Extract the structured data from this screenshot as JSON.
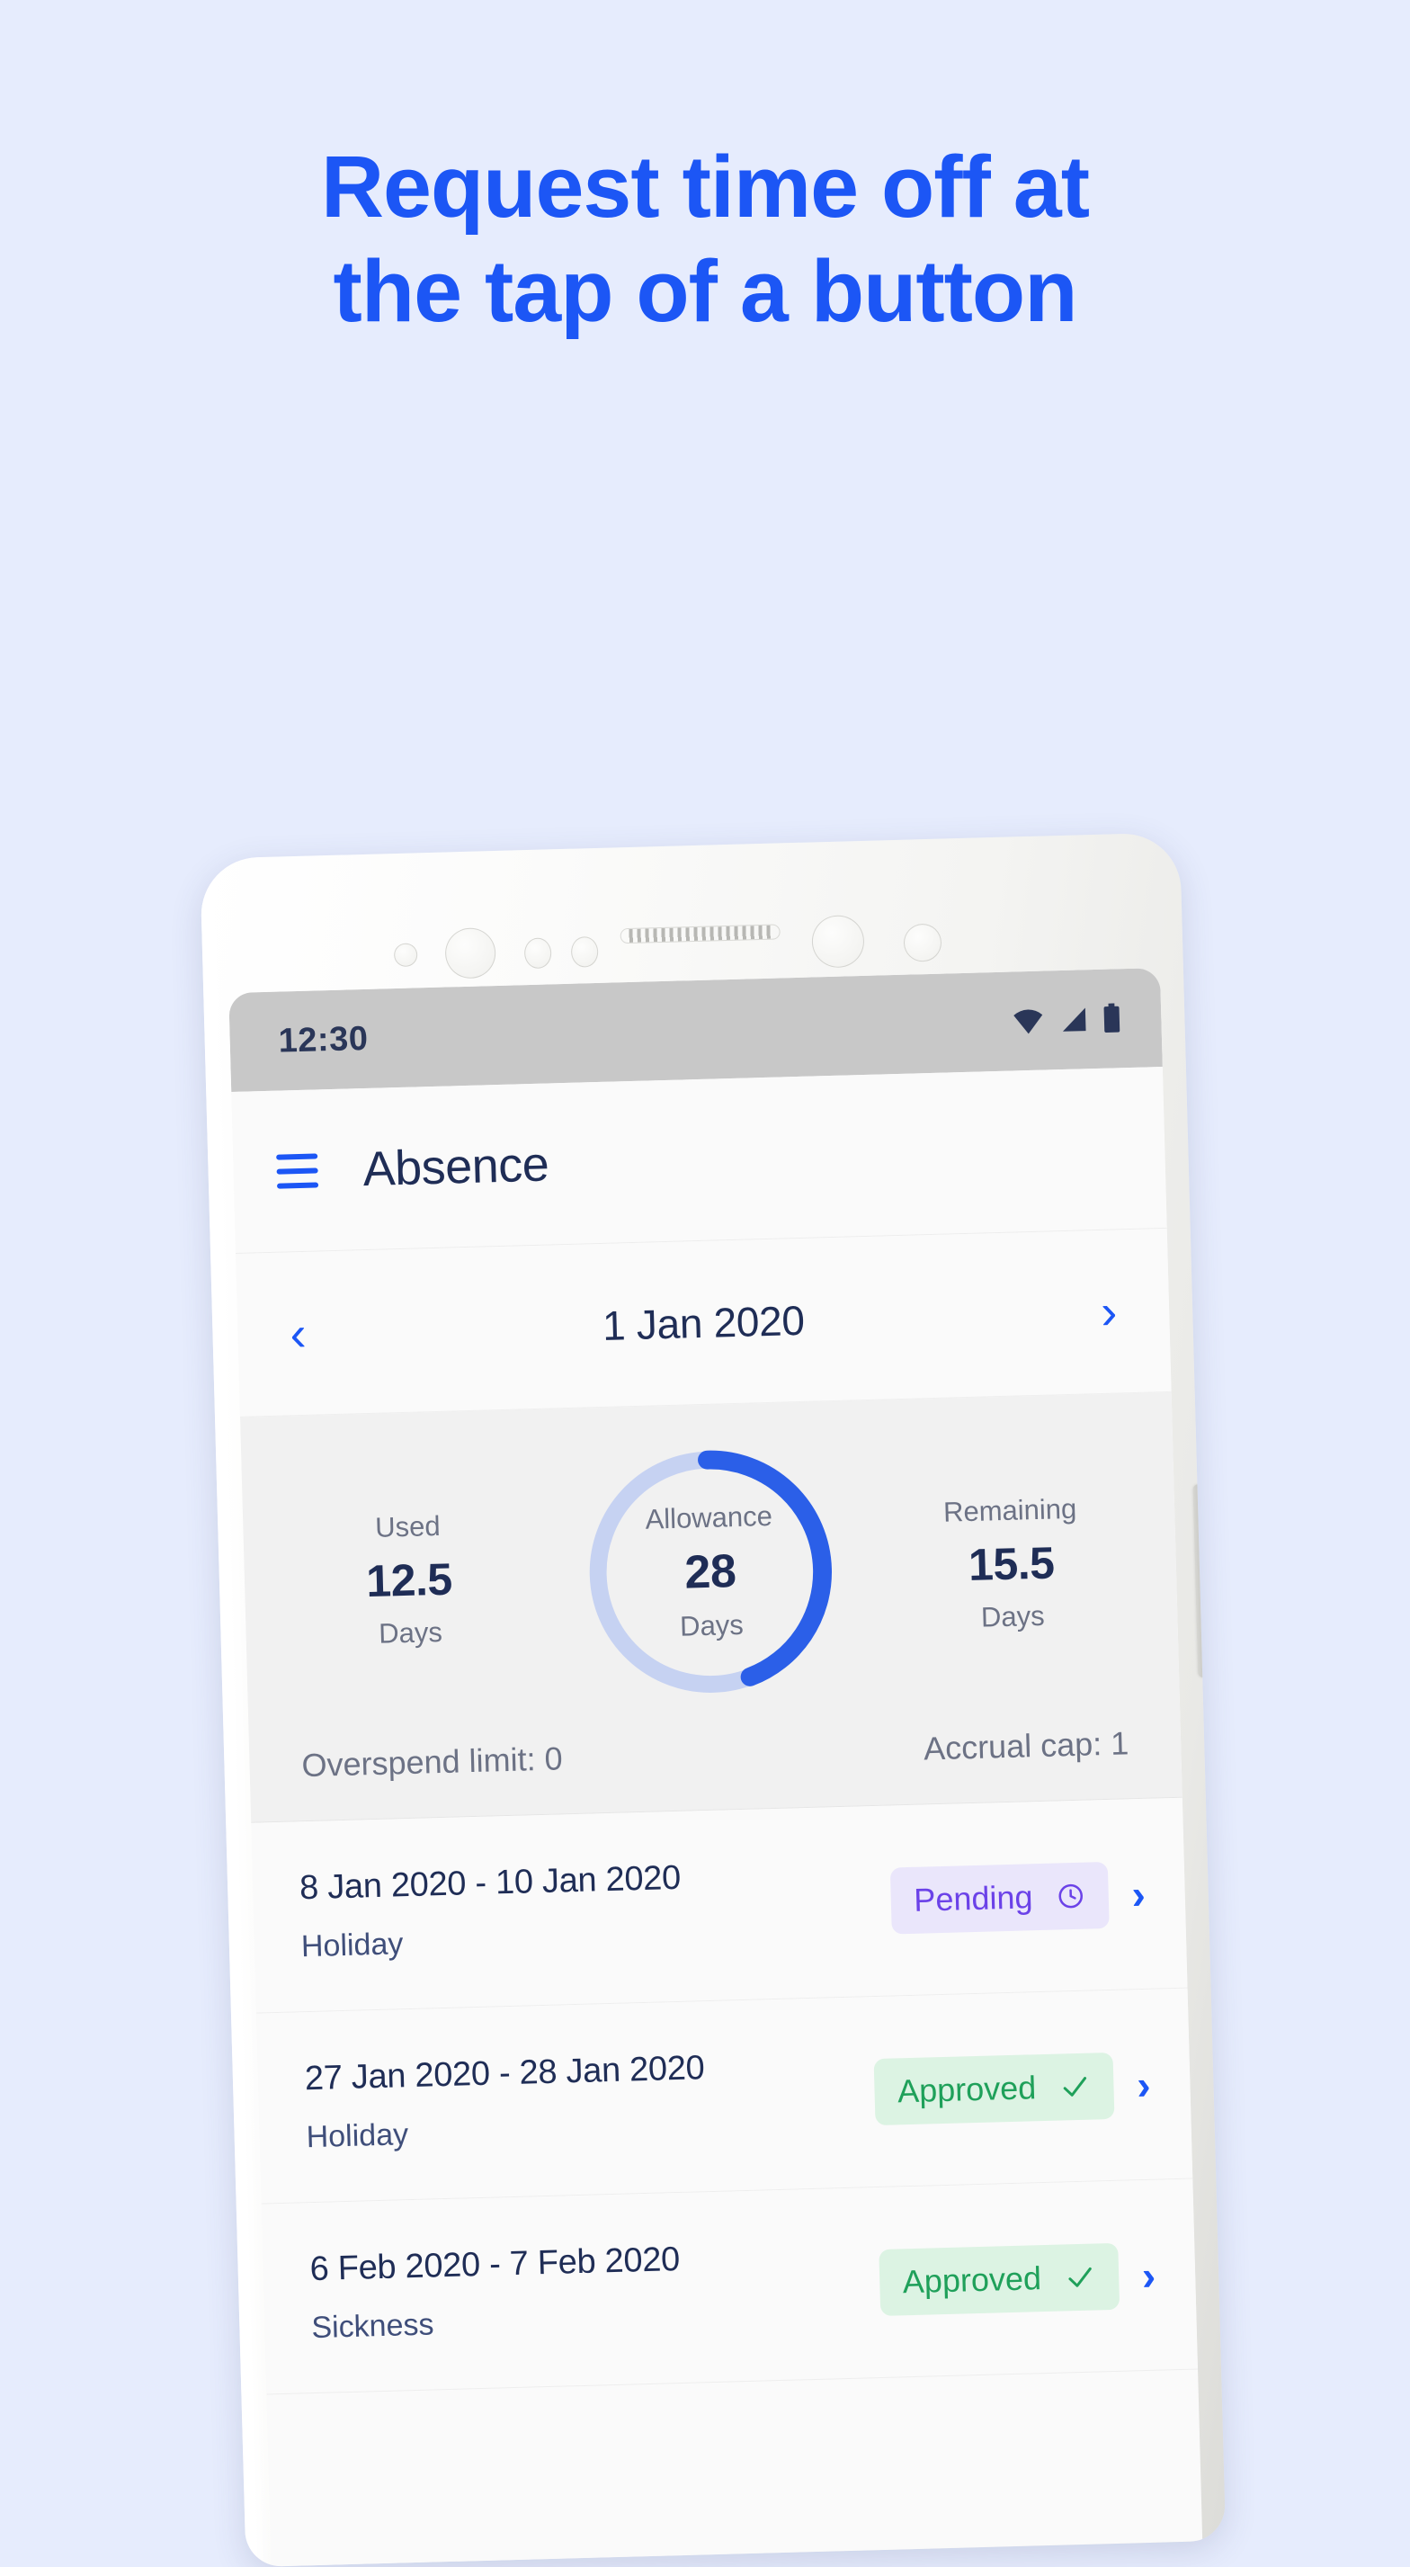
{
  "promo": {
    "headline_line1": "Request time off at",
    "headline_line2": "the tap of a button",
    "accent_color": "#1C56F5",
    "background_color": "#E6ECFD"
  },
  "status_bar": {
    "time": "12:30",
    "icons": [
      "wifi-icon",
      "cellular-signal-icon",
      "battery-icon"
    ]
  },
  "app_bar": {
    "menu_icon": "hamburger-menu-icon",
    "title": "Absence"
  },
  "date_nav": {
    "prev_icon": "chevron-left-icon",
    "date": "1 Jan 2020",
    "next_icon": "chevron-right-icon"
  },
  "summary": {
    "used": {
      "label": "Used",
      "value": "12.5",
      "unit": "Days"
    },
    "allowance": {
      "label": "Allowance",
      "value": "28",
      "unit": "Days"
    },
    "remaining": {
      "label": "Remaining",
      "value": "15.5",
      "unit": "Days"
    },
    "overspend_limit": "Overspend limit: 0",
    "accrual_cap": "Accrual cap: 1",
    "ring_track_color": "#C6D2F2",
    "ring_progress_color": "#2B5FE8"
  },
  "chart_data": {
    "type": "pie",
    "title": "Allowance",
    "categories": [
      "Used",
      "Remaining"
    ],
    "values": [
      12.5,
      15.5
    ],
    "total": 28,
    "unit": "Days",
    "used_fraction": 0.4464,
    "start_angle_deg": 0,
    "sweep_angle_deg": 160.7,
    "colors": [
      "#2B5FE8",
      "#C6D2F2"
    ],
    "center_label": "Allowance",
    "center_value": "28",
    "center_unit": "Days",
    "legend": [
      "Used 12.5 Days",
      "Remaining 15.5 Days"
    ]
  },
  "requests": [
    {
      "range": "8 Jan 2020 - 10 Jan 2020",
      "type": "Holiday",
      "status": "Pending",
      "status_kind": "pending",
      "status_icon": "clock-icon",
      "chevron": "chevron-right-icon"
    },
    {
      "range": "27 Jan 2020 - 28 Jan 2020",
      "type": "Holiday",
      "status": "Approved",
      "status_kind": "approved",
      "status_icon": "check-icon",
      "chevron": "chevron-right-icon"
    },
    {
      "range": "6 Feb 2020 - 7 Feb 2020",
      "type": "Sickness",
      "status": "Approved",
      "status_kind": "approved",
      "status_icon": "check-icon",
      "chevron": "chevron-right-icon"
    }
  ]
}
